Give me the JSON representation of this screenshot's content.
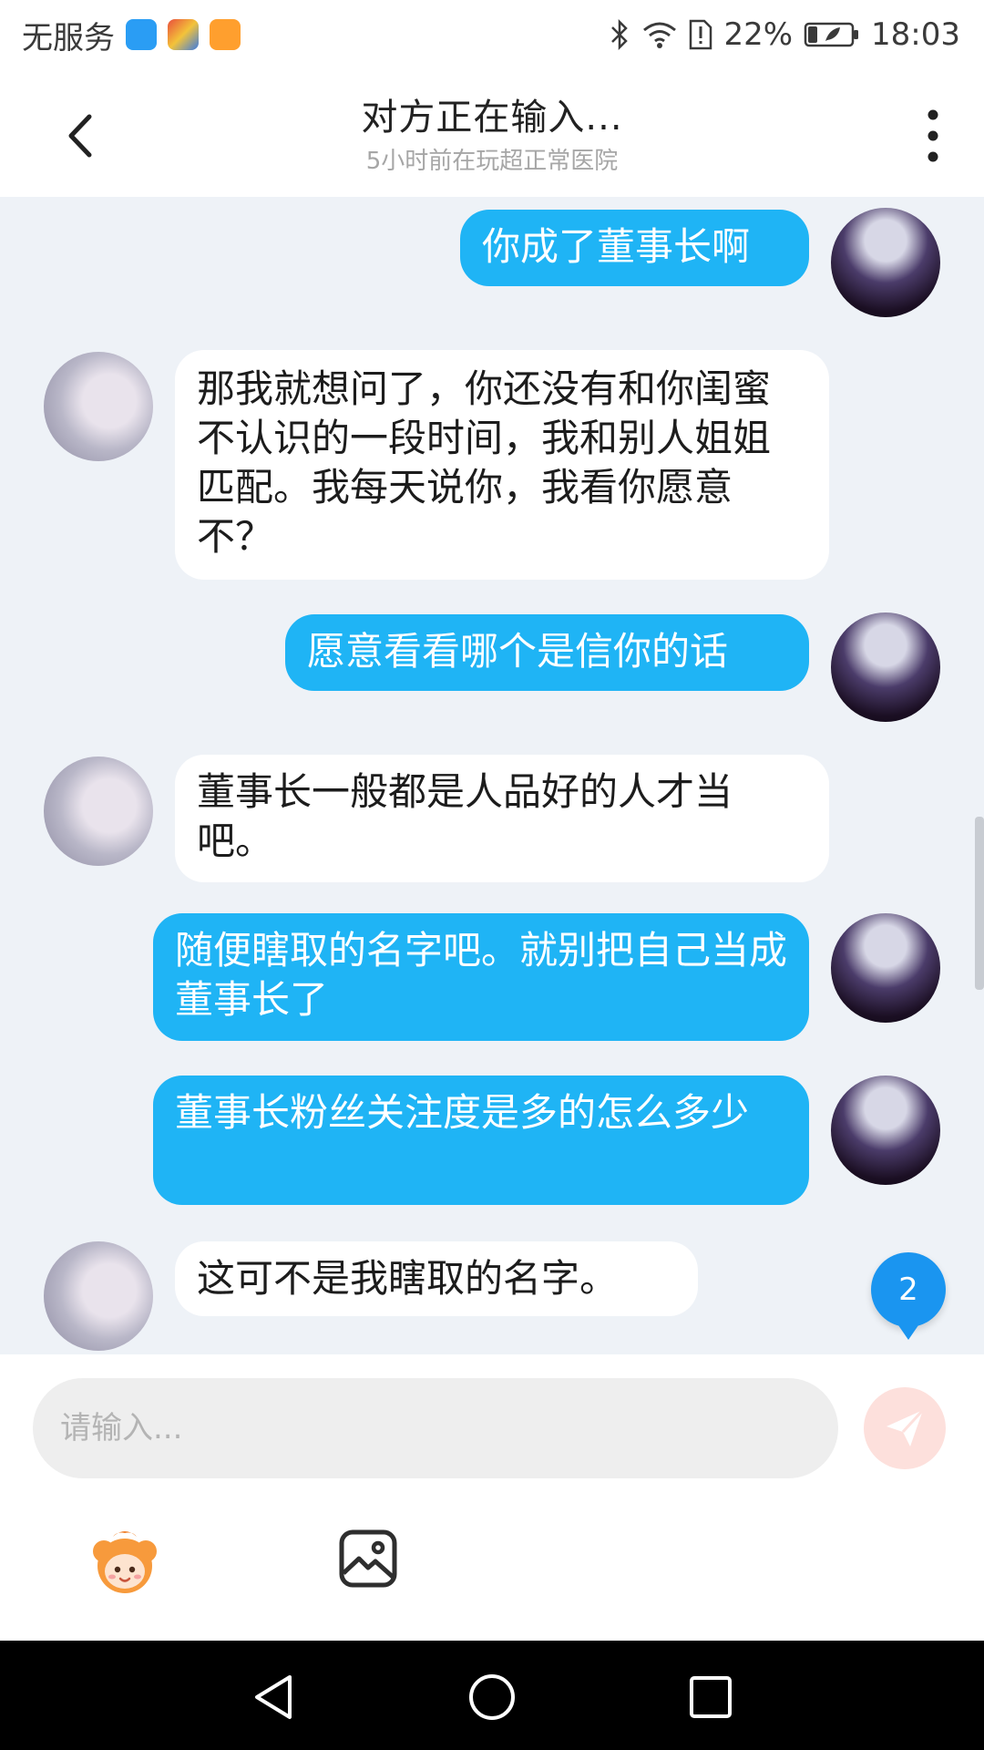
{
  "status_bar": {
    "carrier": "无服务",
    "battery_percent": "22%",
    "time": "18:03"
  },
  "header": {
    "title": "对方正在输入...",
    "subtitle": "5小时前在玩超正常医院"
  },
  "messages": [
    {
      "sender": "self",
      "text": "你成了董事长啊"
    },
    {
      "sender": "other",
      "text": "那我就想问了，你还没有和你闺蜜不认识的一段时间，我和别人姐姐匹配。我每天说你，我看你愿意不？"
    },
    {
      "sender": "self",
      "text": "愿意看看哪个是信你的话"
    },
    {
      "sender": "other",
      "text": "董事长一般都是人品好的人才当吧。"
    },
    {
      "sender": "self",
      "text": "随便瞎取的名字吧。就别把自己当成董事长了"
    },
    {
      "sender": "self",
      "text": "董事长粉丝关注度是多的怎么多少"
    },
    {
      "sender": "other",
      "text": "这可不是我瞎取的名字。"
    }
  ],
  "unread_badge": "2",
  "input": {
    "placeholder": "请输入..."
  },
  "colors": {
    "self_bubble": "#1fb4f5",
    "other_bubble": "#ffffff",
    "chat_background": "#eef2f7",
    "badge": "#1a95f0"
  },
  "icons": {
    "back": "chevron-left-icon",
    "more": "more-vertical-icon",
    "send": "send-icon",
    "emoji": "emoji-icon",
    "image": "image-icon"
  }
}
